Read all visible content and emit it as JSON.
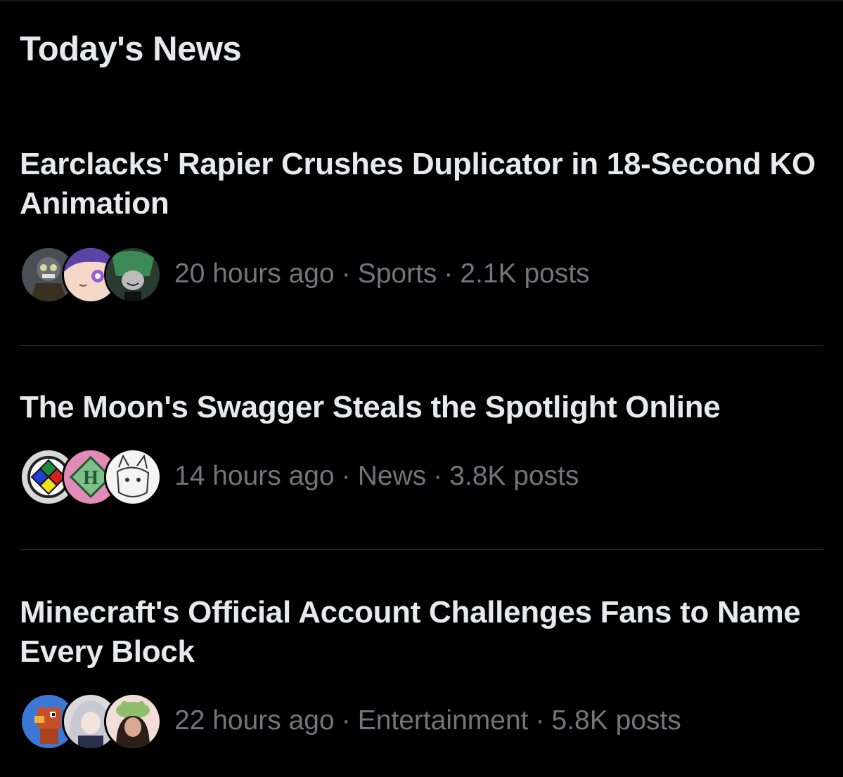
{
  "section": {
    "title": "Today's News"
  },
  "separator": "·",
  "news": [
    {
      "headline": "Earclacks' Rapier Crushes Duplicator in 18-Second KO Animation",
      "time": "20 hours ago",
      "category": "Sports",
      "posts": "2.1K posts",
      "avatars": [
        "robot-avatar",
        "anime-girl-avatar",
        "green-hair-avatar"
      ]
    },
    {
      "headline": "The Moon's Swagger Steals the Spotlight Online",
      "time": "14 hours ago",
      "category": "News",
      "posts": "3.8K posts",
      "avatars": [
        "colored-diamond-avatar",
        "letter-h-avatar",
        "sketch-cat-avatar"
      ]
    },
    {
      "headline": "Minecraft's Official Account Challenges Fans to Name Every Block",
      "time": "22 hours ago",
      "category": "Entertainment",
      "posts": "5.8K posts",
      "avatars": [
        "parrot-avatar",
        "silver-hair-avatar",
        "frog-hat-avatar"
      ]
    }
  ]
}
